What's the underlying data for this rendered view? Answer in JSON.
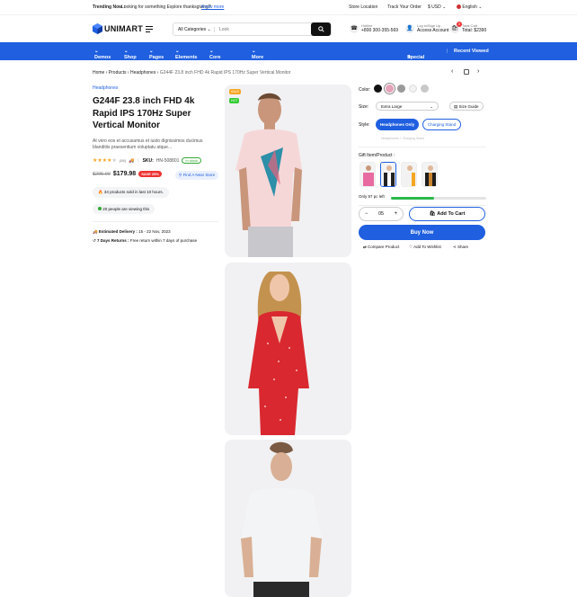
{
  "topbar": {
    "trending_label": "Trending Now :",
    "trending_text": "Looking for something Explore thanksgiving?",
    "know_more": "Know more",
    "store_location": "Store Location",
    "track_order": "Track Your Order",
    "currency": "$ USD",
    "language": "English"
  },
  "header": {
    "logo": "UNIMART",
    "category_select": "All Categories",
    "search_placeholder": "Look",
    "hotline_label": "Hotline",
    "hotline_number": "+800 300-355-569",
    "account_label": "Log in/Sign Up",
    "account_value": "Access Account",
    "cart_label": "Total Cart",
    "cart_total": "Total: $2390",
    "cart_count": "0"
  },
  "nav": {
    "items": [
      "Demos",
      "Shop",
      "Pages",
      "Elements",
      "Core Features",
      "More"
    ],
    "special_offers": "Special Offers",
    "recent_viewed": "Recent Viewed"
  },
  "breadcrumb": {
    "home": "Home",
    "products": "Products",
    "category": "Headphones",
    "current": "G244F 23.8 inch FHD 4k Rapid IPS 170Hz Super Vertical Monitor"
  },
  "product": {
    "category": "Headphones",
    "title": "G244F 23.8 inch FHD 4k Rapid IPS 170Hz Super Vertical Monitor",
    "description": "At vero eos et accusamus et iusto dignissimos ducimus blanditiis praesentium voluptatu atque...",
    "rating": 4,
    "reviews": "(58)",
    "sku_label": "SKU:",
    "sku": "HN-508801",
    "stock_badge": "In stock",
    "old_price": "$295.00",
    "price": "$179.98",
    "discount": "SAVE 25%",
    "find_store": "Find A Near Store",
    "sold_text": "34 products sold in last 10 hours.",
    "viewing_text": "20 people are viewing this",
    "delivery_label": "Estimated Delivery :",
    "delivery_value": "15 - 22 Nov, 2023",
    "returns_label": "7 Days Returns :",
    "returns_value": "Free return within 7 days of purchase",
    "img_badge_sale": "SALE",
    "img_badge_hot": "HOT"
  },
  "options": {
    "color_label": "Color:",
    "colors": [
      "#111111",
      "#e5a2b8",
      "#9a9a9a",
      "#f2f2f2",
      "#c8c8c8"
    ],
    "size_label": "Size:",
    "size_value": "Extra Large",
    "size_guide": "Size Guide",
    "style_label": "Style:",
    "style_active": "Headphones Only",
    "style_other": "Charging Stand",
    "style_note": "Headphones + Charging Stand",
    "gift_label": "Gift Item/Product :",
    "stock_left": "Only 97 pc left",
    "stock_fraction": 0.45,
    "quantity": "05",
    "add_to_cart": "Add To Cart",
    "buy_now": "Buy Now",
    "compare": "Compare Product",
    "wishlist": "Add To Wishlist",
    "share": "Share"
  }
}
